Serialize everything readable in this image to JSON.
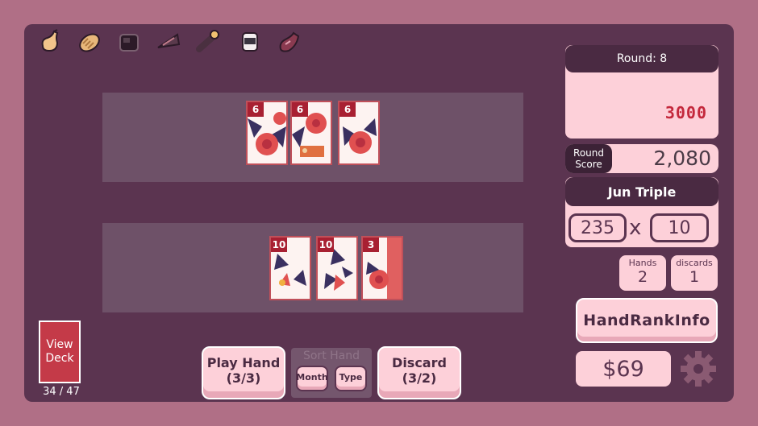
{
  "relics": [
    {
      "name": "pear-relic-icon"
    },
    {
      "name": "bread-relic-icon"
    },
    {
      "name": "pot-relic-icon"
    },
    {
      "name": "pie-relic-icon"
    },
    {
      "name": "bone-relic-icon"
    },
    {
      "name": "jar-relic-icon"
    },
    {
      "name": "drumstick-relic-icon"
    }
  ],
  "played_cards": [
    {
      "value": "6",
      "petal": "#e05050"
    },
    {
      "value": "6",
      "petal": "#e05050"
    },
    {
      "value": "6",
      "petal": "#e05050"
    }
  ],
  "hand_cards": [
    {
      "value": "10",
      "petal": "#e05050"
    },
    {
      "value": "10",
      "petal": "#e05050"
    },
    {
      "value": "3",
      "petal": "#e05050"
    }
  ],
  "round": {
    "label": "Round: 8",
    "target": "3000"
  },
  "round_score": {
    "label_line1": "Round",
    "label_line2": "Score",
    "value": "2,080"
  },
  "hand": {
    "name": "Jun Triple",
    "chips": "235",
    "mult_sign": "x",
    "mult": "10"
  },
  "hands_stat": {
    "label": "Hands",
    "value": "2"
  },
  "discards_stat": {
    "label": "discards",
    "value": "1"
  },
  "hand_rank_info": "HandRankInfo",
  "money": "$69",
  "deck": {
    "line1": "View",
    "line2": "Deck",
    "count": "34 / 47"
  },
  "buttons": {
    "play_line1": "Play Hand",
    "play_line2": "(3/3)",
    "sort_title": "Sort Hand",
    "sort_month": "Month",
    "sort_type": "Type",
    "discard_line1": "Discard",
    "discard_line2": "(3/2)"
  },
  "colors": {
    "board": "#5b3450",
    "frame": "#b06f86",
    "panel": "#fdd0d9",
    "accent": "#c4283c"
  }
}
